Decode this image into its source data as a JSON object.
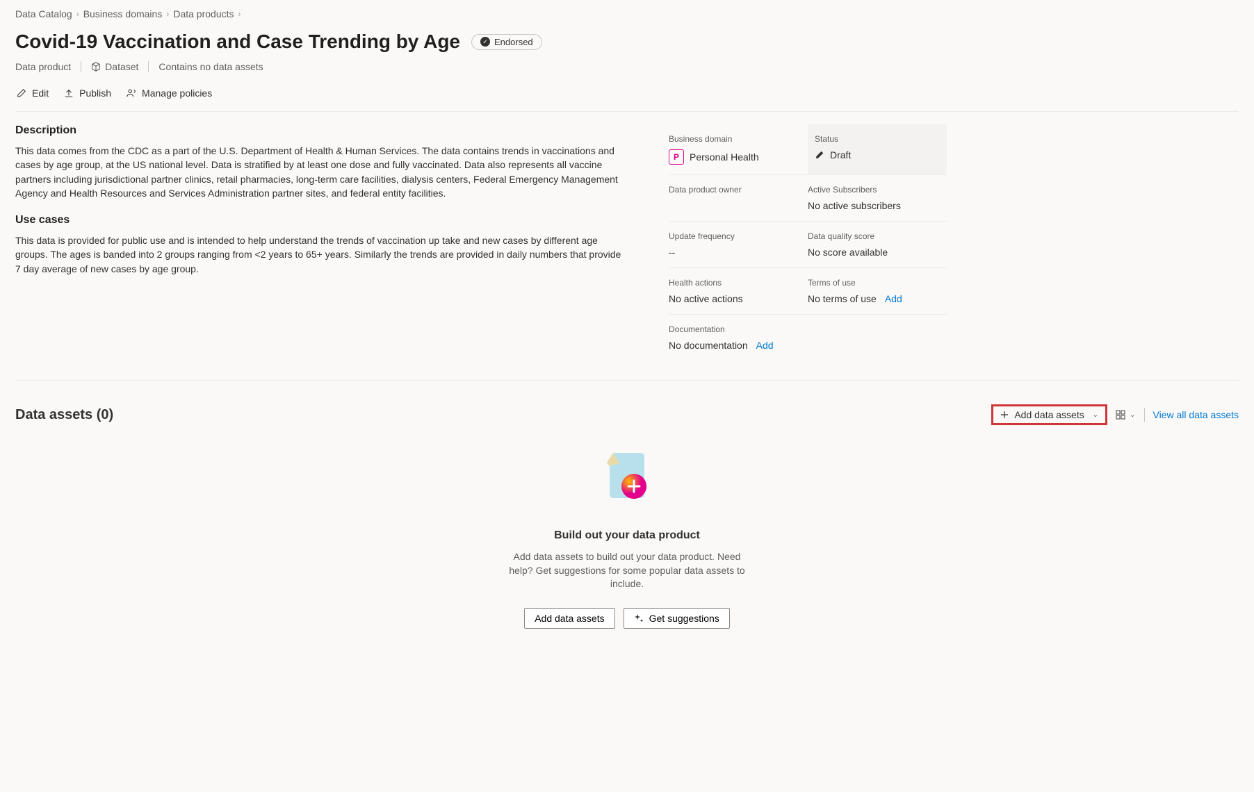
{
  "breadcrumb": {
    "items": [
      "Data Catalog",
      "Business domains",
      "Data products"
    ]
  },
  "title": "Covid-19 Vaccination and Case Trending by Age",
  "endorsed_label": "Endorsed",
  "meta": {
    "data_product": "Data product",
    "dataset": "Dataset",
    "no_assets": "Contains no data assets"
  },
  "toolbar": {
    "edit": "Edit",
    "publish": "Publish",
    "manage_policies": "Manage policies"
  },
  "description": {
    "heading": "Description",
    "text": "This data comes from the CDC as a part of the U.S. Department of Health & Human Services.  The data contains trends in vaccinations and cases by age group, at the US national level. Data is stratified by at least one dose and fully vaccinated. Data also represents all vaccine partners including jurisdictional partner clinics, retail pharmacies, long-term care facilities, dialysis centers, Federal Emergency Management Agency and Health Resources and Services Administration partner sites, and federal entity facilities."
  },
  "use_cases": {
    "heading": "Use cases",
    "text": "This data is provided for public use and is intended to help understand the trends of vaccination up take and new cases by different age groups.  The ages is banded into 2 groups ranging from <2 years to 65+ years.  Similarly the trends are provided in daily numbers that provide 7 day average of new cases by age group."
  },
  "side": {
    "business_domain": {
      "label": "Business domain",
      "badge": "P",
      "value": "Personal Health"
    },
    "status": {
      "label": "Status",
      "value": "Draft"
    },
    "owner": {
      "label": "Data product owner",
      "value": ""
    },
    "subscribers": {
      "label": "Active Subscribers",
      "value": "No active subscribers"
    },
    "update_freq": {
      "label": "Update frequency",
      "value": "--"
    },
    "quality": {
      "label": "Data quality score",
      "value": "No score available"
    },
    "health": {
      "label": "Health actions",
      "value": "No active actions"
    },
    "terms": {
      "label": "Terms of use",
      "value": "No terms of use",
      "link": "Add"
    },
    "docs": {
      "label": "Documentation",
      "value": "No documentation",
      "link": "Add"
    }
  },
  "assets": {
    "heading": "Data assets (0)",
    "add_btn": "Add data assets",
    "view_all": "View all data assets",
    "empty_title": "Build out your data product",
    "empty_text": "Add data assets to build out your data product. Need help? Get suggestions for some popular data assets to include.",
    "btn_add": "Add data assets",
    "btn_suggest": "Get suggestions"
  }
}
